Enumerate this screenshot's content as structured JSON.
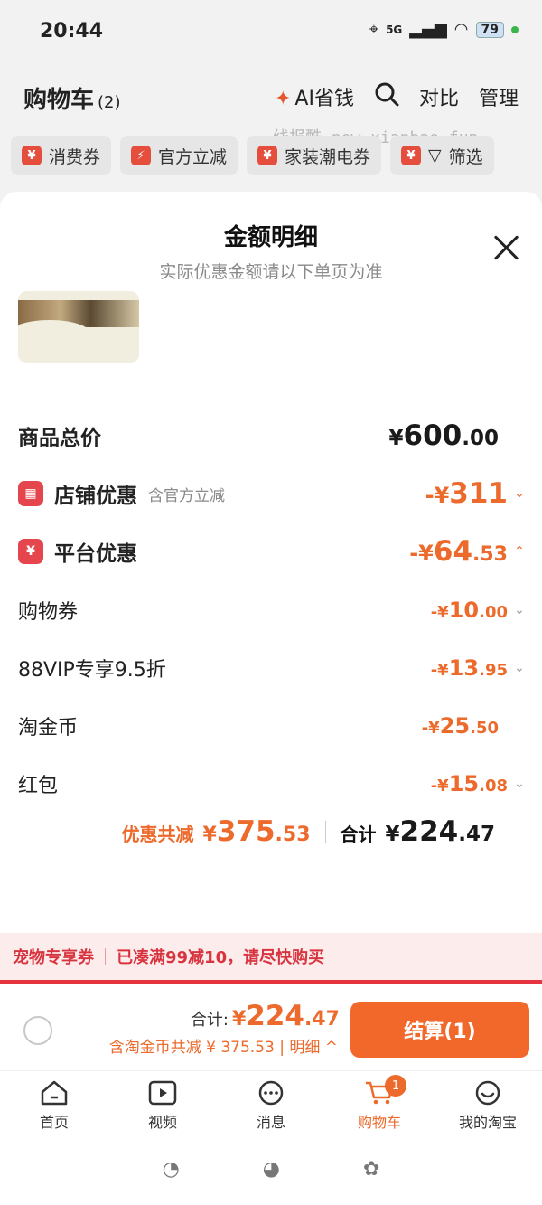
{
  "status": {
    "time": "20:44",
    "network": "5G",
    "battery": "79"
  },
  "header": {
    "title": "购物车",
    "count": "(2)",
    "ai_label": "AI省钱",
    "compare_label": "对比",
    "manage_label": "管理"
  },
  "watermark": "线报酷-new.xianbao.fun",
  "filters": [
    {
      "label": "消费券",
      "icon": "¥"
    },
    {
      "label": "官方立减",
      "icon": "⚡"
    },
    {
      "label": "家装潮电券",
      "icon": "¥"
    },
    {
      "label": "筛选",
      "icon": "¥"
    }
  ],
  "sheet": {
    "title": "金额明细",
    "subtitle": "实际优惠金额请以下单页为准",
    "rows": {
      "total": {
        "label": "商品总价",
        "yen": "¥",
        "int": "600",
        "dec": ".00"
      },
      "store": {
        "label": "店铺优惠",
        "sub": "含官方立减",
        "prefix": "-¥",
        "int": "311"
      },
      "platform": {
        "label": "平台优惠",
        "prefix": "-¥",
        "int": "64",
        "dec": ".53"
      },
      "coupon": {
        "label": "购物券",
        "prefix": "-¥",
        "int": "10",
        "dec": ".00"
      },
      "vip": {
        "label": "88VIP专享9.5折",
        "prefix": "-¥",
        "int": "13",
        "dec": ".95"
      },
      "coin": {
        "label": "淘金币",
        "prefix": "-¥",
        "int": "25",
        "dec": ".50"
      },
      "redpack": {
        "label": "红包",
        "prefix": "-¥",
        "int": "15",
        "dec": ".08"
      }
    },
    "summary": {
      "discount_label": "优惠共减",
      "discount_yen": "¥",
      "discount_int": "375",
      "discount_dec": ".53",
      "total_label": "合计",
      "total_yen": "¥",
      "total_int": "224",
      "total_dec": ".47"
    }
  },
  "pet_banner": {
    "left": "宠物专享券",
    "right": "已凑满99减10，请尽快购买"
  },
  "checkout": {
    "total_label": "合计:",
    "yen": "¥",
    "int": "224",
    "dec": ".47",
    "sub": "含淘金币共减 ¥ 375.53 | 明细 ^",
    "button": "结算(1)"
  },
  "tabs": [
    {
      "label": "首页",
      "icon": "home-icon"
    },
    {
      "label": "视频",
      "icon": "video-icon"
    },
    {
      "label": "消息",
      "icon": "message-icon"
    },
    {
      "label": "购物车",
      "icon": "cart-icon",
      "badge": "1"
    },
    {
      "label": "我的淘宝",
      "icon": "profile-icon"
    }
  ],
  "colors": {
    "accent": "#ec6a2c",
    "red": "#e5454d",
    "checkout": "#f2682b"
  }
}
